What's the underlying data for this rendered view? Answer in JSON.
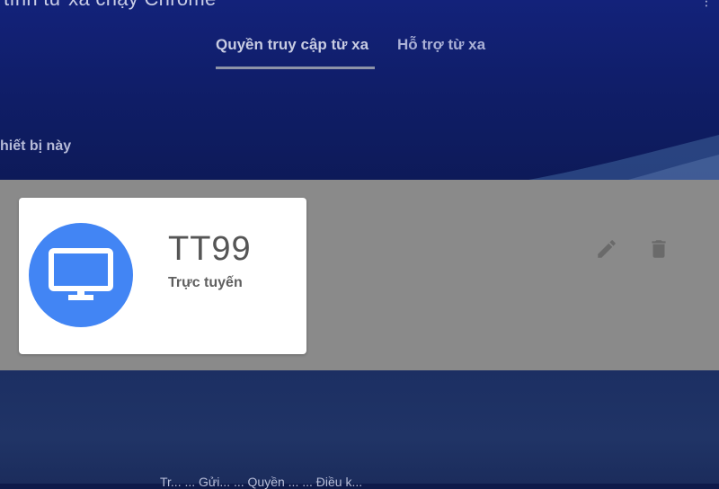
{
  "header": {
    "title_partial": "tính từ xa chạy Chrome",
    "tabs": [
      {
        "label": "Quyền truy cập từ xa",
        "active": true
      },
      {
        "label": "Hỗ trợ từ xa",
        "active": false
      }
    ],
    "section_label_partial": "hiết bị này"
  },
  "device": {
    "name": "TT99",
    "status": "Trực tuyến",
    "icon": "monitor-icon",
    "accent_color": "#4285f4"
  },
  "actions": {
    "edit_icon": "pencil-icon",
    "delete_icon": "trash-icon"
  },
  "footer": {
    "links_partial": "Tr... ... Gửi... ... Quyền ... ... Điều k..."
  }
}
